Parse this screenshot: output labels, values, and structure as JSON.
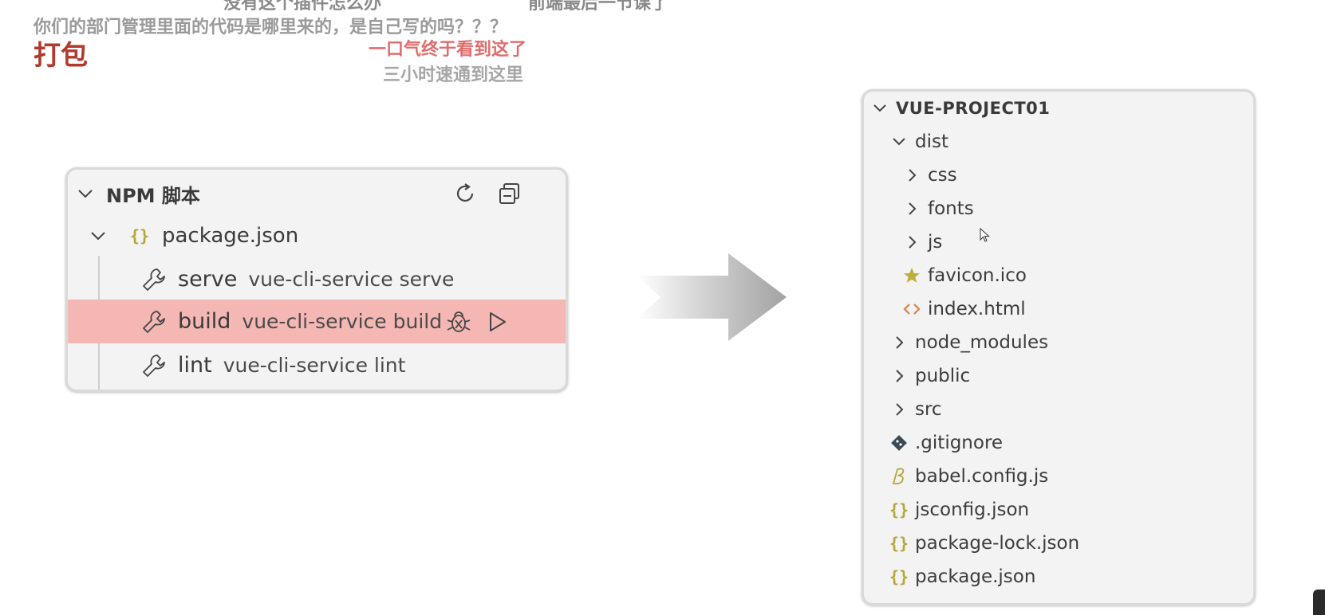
{
  "danmaku": {
    "top_left": "没有这个插件怎么办",
    "top_mid": "前端最后一节课了",
    "question": "你们的部门管理里面的代码是哪里来的，是自己写的吗？？？",
    "red": "一口气终于看到这了",
    "gray": "三小时速通到这里"
  },
  "slide": {
    "title": "打包"
  },
  "npm_panel": {
    "header": "NPM 脚本",
    "refresh_icon": "refresh-icon",
    "collapse_icon": "collapse-all-icon",
    "package_file": "package.json",
    "scripts": [
      {
        "name": "serve",
        "command": "vue-cli-service serve",
        "highlighted": false
      },
      {
        "name": "build",
        "command": "vue-cli-service build",
        "highlighted": true
      },
      {
        "name": "lint",
        "command": "vue-cli-service lint",
        "highlighted": false
      }
    ],
    "highlight_color": "#f4b7b3"
  },
  "explorer": {
    "root": "VUE-PROJECT01",
    "items": [
      {
        "label": "dist",
        "kind": "folder",
        "expanded": true
      },
      {
        "label": "css",
        "kind": "folder"
      },
      {
        "label": "fonts",
        "kind": "folder"
      },
      {
        "label": "js",
        "kind": "folder"
      },
      {
        "label": "favicon.ico",
        "kind": "file",
        "icon": "star-icon"
      },
      {
        "label": "index.html",
        "kind": "file",
        "icon": "html-icon"
      },
      {
        "label": "node_modules",
        "kind": "folder"
      },
      {
        "label": "public",
        "kind": "folder"
      },
      {
        "label": "src",
        "kind": "folder"
      },
      {
        "label": ".gitignore",
        "kind": "file",
        "icon": "git-icon"
      },
      {
        "label": "babel.config.js",
        "kind": "file",
        "icon": "babel-icon"
      },
      {
        "label": "jsconfig.json",
        "kind": "file",
        "icon": "json-icon"
      },
      {
        "label": "package-lock.json",
        "kind": "file",
        "icon": "json-icon"
      },
      {
        "label": "package.json",
        "kind": "file",
        "icon": "json-icon"
      }
    ]
  },
  "colors": {
    "title_red": "#b03a2e",
    "json_icon": "#b5a53a",
    "html_icon": "#d9824a",
    "star_icon": "#bfae3a"
  }
}
